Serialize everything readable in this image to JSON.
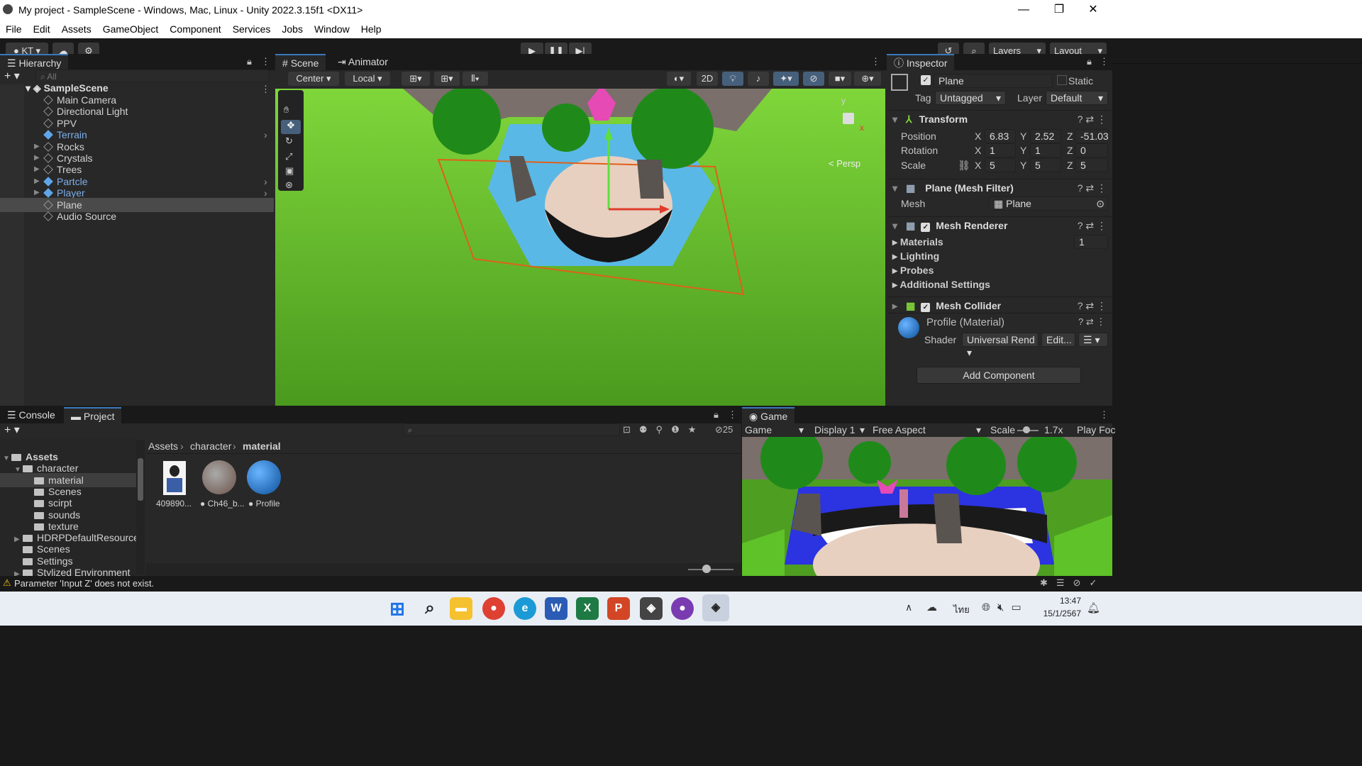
{
  "window": {
    "title": "My project - SampleScene - Windows, Mac, Linux - Unity 2022.3.15f1 <DX11>",
    "minimize": "—",
    "restore": "❐",
    "close": "✕"
  },
  "menu": [
    "File",
    "Edit",
    "Assets",
    "GameObject",
    "Component",
    "Services",
    "Jobs",
    "Window",
    "Help"
  ],
  "toolbar": {
    "account": "KT",
    "layers": "Layers",
    "layout": "Layout"
  },
  "hierarchy": {
    "tab": "Hierarchy",
    "search_placeholder": "All",
    "scene": "SampleScene",
    "items": [
      {
        "label": "Main Camera",
        "style": "normal"
      },
      {
        "label": "Directional Light",
        "style": "normal"
      },
      {
        "label": "PPV",
        "style": "normal"
      },
      {
        "label": "Terrain",
        "style": "prefab"
      },
      {
        "label": "Rocks",
        "style": "normal"
      },
      {
        "label": "Crystals",
        "style": "normal"
      },
      {
        "label": "Trees",
        "style": "normal"
      },
      {
        "label": "Partcle",
        "style": "prefab"
      },
      {
        "label": "Player",
        "style": "prefab"
      },
      {
        "label": "Plane",
        "style": "selected"
      },
      {
        "label": "Audio Source",
        "style": "normal"
      }
    ]
  },
  "scene": {
    "tabs": [
      "Scene",
      "Animator"
    ],
    "pivot": "Center",
    "space": "Local",
    "mode2d": "2D",
    "persp": "< Persp",
    "gizmo_y": "y",
    "gizmo_x": "x"
  },
  "inspector": {
    "tab": "Inspector",
    "object_name": "Plane",
    "static_label": "Static",
    "tag_label": "Tag",
    "tag": "Untagged",
    "layer_label": "Layer",
    "layer": "Default",
    "transform": {
      "title": "Transform",
      "position_label": "Position",
      "rotation_label": "Rotation",
      "scale_label": "Scale",
      "position": {
        "x": "6.83",
        "y": "2.52",
        "z": "-51.03"
      },
      "rotation": {
        "x": "1",
        "y": "1",
        "z": "0"
      },
      "scale": {
        "x": "5",
        "y": "5",
        "z": "5"
      }
    },
    "mesh_filter": {
      "title": "Plane (Mesh Filter)",
      "mesh_label": "Mesh",
      "mesh": "Plane"
    },
    "mesh_renderer": {
      "title": "Mesh Renderer",
      "materials": "Materials",
      "materials_count": "1",
      "lighting": "Lighting",
      "probes": "Probes",
      "additional": "Additional Settings"
    },
    "mesh_collider": {
      "title": "Mesh Collider"
    },
    "material": {
      "title": "Profile (Material)",
      "shader_label": "Shader",
      "shader": "Universal Rend",
      "edit": "Edit..."
    },
    "add_component": "Add Component"
  },
  "bottom": {
    "tabs": [
      "Console",
      "Project"
    ],
    "hidden_count": "25",
    "breadcrumb": [
      "Assets",
      "character",
      "material"
    ],
    "tree": [
      {
        "label": "Assets",
        "level": 0,
        "bold": true
      },
      {
        "label": "character",
        "level": 1
      },
      {
        "label": "material",
        "level": 2,
        "selected": true
      },
      {
        "label": "Scenes",
        "level": 2
      },
      {
        "label": "scirpt",
        "level": 2
      },
      {
        "label": "sounds",
        "level": 2
      },
      {
        "label": "texture",
        "level": 2
      },
      {
        "label": "HDRPDefaultResources",
        "level": 1
      },
      {
        "label": "Scenes",
        "level": 1
      },
      {
        "label": "Settings",
        "level": 1
      },
      {
        "label": "Stylized Environment",
        "level": 1
      }
    ],
    "assets": [
      {
        "label": "409890..."
      },
      {
        "label": "Ch46_b..."
      },
      {
        "label": "Profile"
      }
    ]
  },
  "game": {
    "tab": "Game",
    "mode": "Game",
    "display": "Display 1",
    "aspect": "Free Aspect",
    "scale_label": "Scale",
    "scale": "1.7x",
    "play_focused": "Play Foc"
  },
  "status": {
    "message": "Parameter 'Input Z' does not exist."
  },
  "taskbar": {
    "time": "13:47",
    "date": "15/1/2567",
    "lang": "ไทย"
  }
}
